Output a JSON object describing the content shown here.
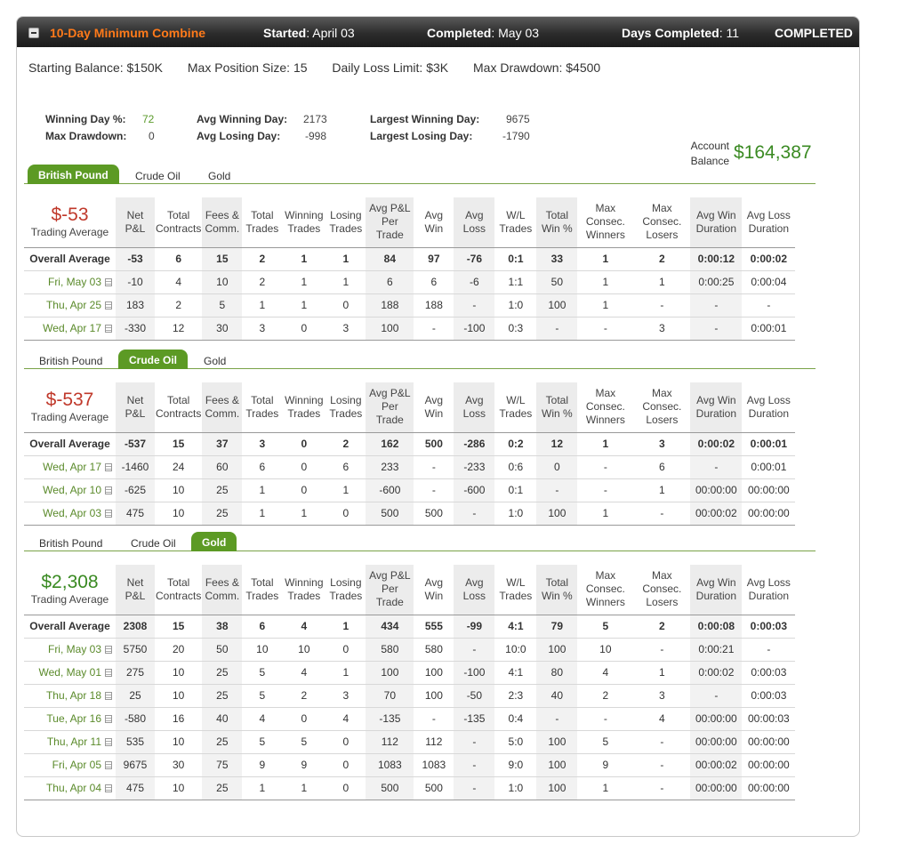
{
  "header": {
    "title": "10-Day Minimum Combine",
    "started_label": "Started",
    "started_value": "April 03",
    "completed_label": "Completed",
    "completed_value": "May 03",
    "days_label": "Days Completed",
    "days_value": "11",
    "status": "COMPLETED"
  },
  "rules": {
    "starting_balance": "Starting Balance: $150K",
    "max_position": "Max Position Size: 15",
    "daily_loss": "Daily Loss Limit: $3K",
    "max_drawdown": "Max Drawdown: $4500"
  },
  "stats": {
    "winning_day_label": "Winning Day %:",
    "winning_day_value": "72",
    "max_drawdown_label": "Max Drawdown:",
    "max_drawdown_value": "0",
    "avg_winning_label": "Avg Winning Day:",
    "avg_winning_value": "2173",
    "avg_losing_label": "Avg Losing Day:",
    "avg_losing_value": "-998",
    "largest_winning_label": "Largest Winning Day:",
    "largest_winning_value": "9675",
    "largest_losing_label": "Largest Losing Day:",
    "largest_losing_value": "-1790"
  },
  "account": {
    "label": "Account Balance",
    "value": "$164,387"
  },
  "tabs": [
    "British Pound",
    "Crude Oil",
    "Gold"
  ],
  "columns": [
    "Net P&L",
    "Total Contracts",
    "Fees & Comm.",
    "Total Trades",
    "Winning Trades",
    "Losing Trades",
    "Avg P&L Per Trade",
    "Avg Win",
    "Avg Loss",
    "W/L Trades",
    "Total Win %",
    "Max Consec. Winners",
    "Max Consec. Losers",
    "Avg Win Duration",
    "Avg Loss Duration"
  ],
  "colors": {
    "accent": "#5c9a24",
    "loss": "#c0392b",
    "gain": "#3a8a22",
    "title": "#ff7a1a"
  },
  "sections": [
    {
      "active_tab": 0,
      "summary_value": "$-53",
      "summary_color": "red",
      "summary_label": "Trading Average",
      "rows": [
        {
          "label": "Overall Average",
          "overall": true,
          "cells": [
            "-53",
            "6",
            "15",
            "2",
            "1",
            "1",
            "84",
            "97",
            "-76",
            "0:1",
            "33",
            "1",
            "2",
            "0:00:12",
            "0:00:02"
          ]
        },
        {
          "label": "Fri, May 03",
          "cells": [
            "-10",
            "4",
            "10",
            "2",
            "1",
            "1",
            "6",
            "6",
            "-6",
            "1:1",
            "50",
            "1",
            "1",
            "0:00:25",
            "0:00:04"
          ]
        },
        {
          "label": "Thu, Apr 25",
          "cells": [
            "183",
            "2",
            "5",
            "1",
            "1",
            "0",
            "188",
            "188",
            "-",
            "1:0",
            "100",
            "1",
            "-",
            "-",
            "-"
          ]
        },
        {
          "label": "Wed, Apr 17",
          "cells": [
            "-330",
            "12",
            "30",
            "3",
            "0",
            "3",
            "100",
            "-",
            "-100",
            "0:3",
            "-",
            "-",
            "3",
            "-",
            "0:00:01"
          ]
        }
      ]
    },
    {
      "active_tab": 1,
      "summary_value": "$-537",
      "summary_color": "red",
      "summary_label": "Trading Average",
      "rows": [
        {
          "label": "Overall Average",
          "overall": true,
          "cells": [
            "-537",
            "15",
            "37",
            "3",
            "0",
            "2",
            "162",
            "500",
            "-286",
            "0:2",
            "12",
            "1",
            "3",
            "0:00:02",
            "0:00:01"
          ]
        },
        {
          "label": "Wed, Apr 17",
          "cells": [
            "-1460",
            "24",
            "60",
            "6",
            "0",
            "6",
            "233",
            "-",
            "-233",
            "0:6",
            "0",
            "-",
            "6",
            "-",
            "0:00:01"
          ]
        },
        {
          "label": "Wed, Apr 10",
          "cells": [
            "-625",
            "10",
            "25",
            "1",
            "0",
            "1",
            "-600",
            "-",
            "-600",
            "0:1",
            "-",
            "-",
            "1",
            "00:00:00",
            "00:00:00"
          ]
        },
        {
          "label": "Wed, Apr 03",
          "cells": [
            "475",
            "10",
            "25",
            "1",
            "1",
            "0",
            "500",
            "500",
            "-",
            "1:0",
            "100",
            "1",
            "-",
            "00:00:02",
            "00:00:00"
          ]
        }
      ]
    },
    {
      "active_tab": 2,
      "summary_value": "$2,308",
      "summary_color": "green",
      "summary_label": "Trading Average",
      "rows": [
        {
          "label": "Overall Average",
          "overall": true,
          "cells": [
            "2308",
            "15",
            "38",
            "6",
            "4",
            "1",
            "434",
            "555",
            "-99",
            "4:1",
            "79",
            "5",
            "2",
            "0:00:08",
            "0:00:03"
          ]
        },
        {
          "label": "Fri, May 03",
          "cells": [
            "5750",
            "20",
            "50",
            "10",
            "10",
            "0",
            "580",
            "580",
            "-",
            "10:0",
            "100",
            "10",
            "-",
            "0:00:21",
            "-"
          ]
        },
        {
          "label": "Wed, May 01",
          "cells": [
            "275",
            "10",
            "25",
            "5",
            "4",
            "1",
            "100",
            "100",
            "-100",
            "4:1",
            "80",
            "4",
            "1",
            "0:00:02",
            "0:00:03"
          ]
        },
        {
          "label": "Thu, Apr 18",
          "cells": [
            "25",
            "10",
            "25",
            "5",
            "2",
            "3",
            "70",
            "100",
            "-50",
            "2:3",
            "40",
            "2",
            "3",
            "-",
            "0:00:03"
          ]
        },
        {
          "label": "Tue, Apr 16",
          "cells": [
            "-580",
            "16",
            "40",
            "4",
            "0",
            "4",
            "-135",
            "-",
            "-135",
            "0:4",
            "-",
            "-",
            "4",
            "00:00:00",
            "00:00:03"
          ]
        },
        {
          "label": "Thu, Apr 11",
          "cells": [
            "535",
            "10",
            "25",
            "5",
            "5",
            "0",
            "112",
            "112",
            "-",
            "5:0",
            "100",
            "5",
            "-",
            "00:00:00",
            "00:00:00"
          ]
        },
        {
          "label": "Fri, Apr 05",
          "cells": [
            "9675",
            "30",
            "75",
            "9",
            "9",
            "0",
            "1083",
            "1083",
            "-",
            "9:0",
            "100",
            "9",
            "-",
            "00:00:02",
            "00:00:00"
          ]
        },
        {
          "label": "Thu, Apr 04",
          "cells": [
            "475",
            "10",
            "25",
            "1",
            "1",
            "0",
            "500",
            "500",
            "-",
            "1:0",
            "100",
            "1",
            "-",
            "00:00:00",
            "00:00:00"
          ]
        }
      ]
    }
  ]
}
